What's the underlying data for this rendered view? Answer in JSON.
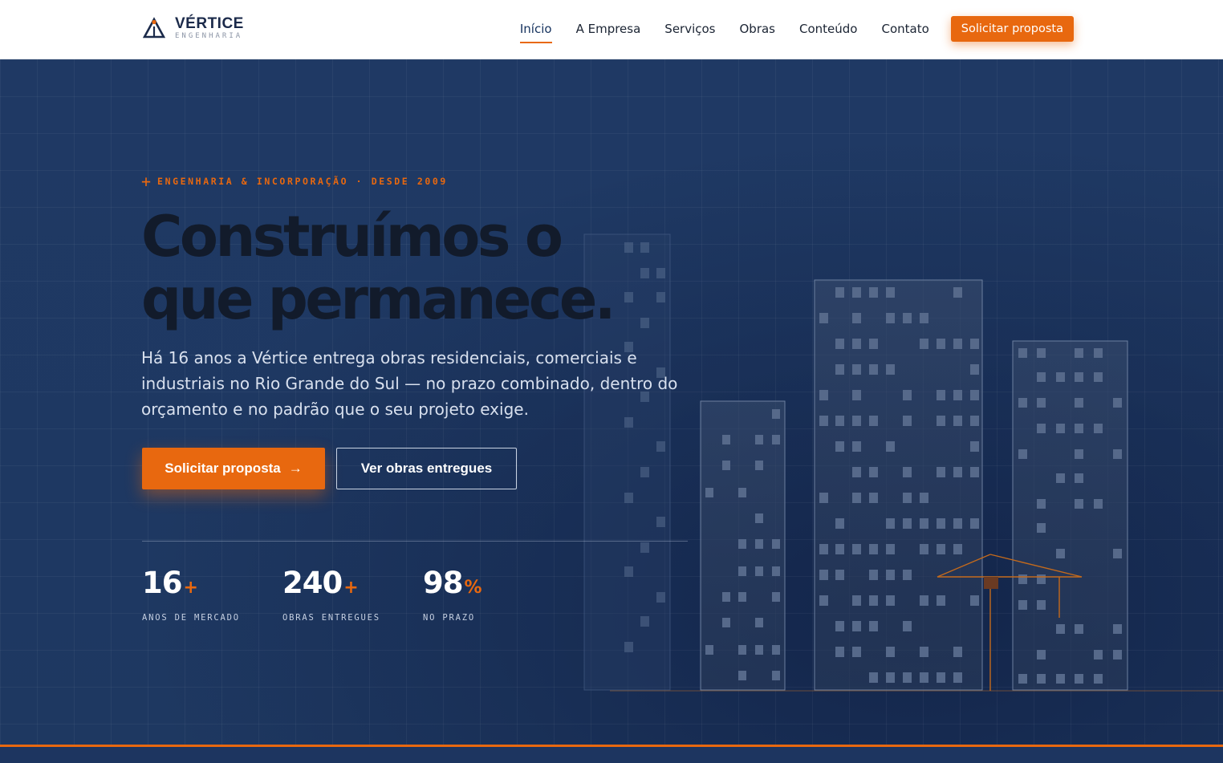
{
  "brand": {
    "name": "VÉRTICE",
    "tagline": "ENGENHARIA"
  },
  "nav": {
    "items": [
      {
        "label": "Início",
        "active": true
      },
      {
        "label": "A Empresa"
      },
      {
        "label": "Serviços"
      },
      {
        "label": "Obras"
      },
      {
        "label": "Conteúdo"
      },
      {
        "label": "Contato"
      }
    ],
    "cta": "Solicitar proposta"
  },
  "hero": {
    "eyebrow": "ENGENHARIA & INCORPORAÇÃO · DESDE 2009",
    "headline_line1": "Construímos o",
    "headline_line2": "que permanece.",
    "lead": "Há 16 anos a Vértice entrega obras residenciais, comerciais e industriais no Rio Grande do Sul — no prazo combinado, dentro do orçamento e no padrão que o seu projeto exige.",
    "primary_button": "Solicitar proposta",
    "primary_arrow": "→",
    "secondary_button": "Ver obras entregues"
  },
  "stats": [
    {
      "value": "16",
      "suffix": "+",
      "label": "ANOS DE MERCADO"
    },
    {
      "value": "240",
      "suffix": "+",
      "label": "OBRAS ENTREGUES"
    },
    {
      "value": "98",
      "suffix": "%",
      "label": "NO PRAZO"
    }
  ],
  "colors": {
    "accent": "#e8680f",
    "navy": "#1d3560",
    "ink": "#121b2b"
  }
}
